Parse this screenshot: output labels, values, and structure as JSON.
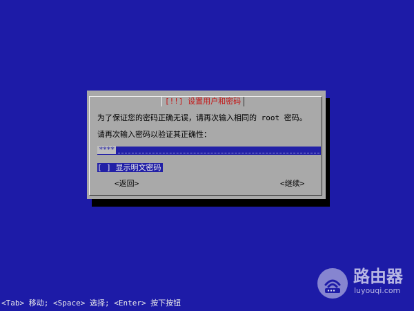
{
  "dialog": {
    "title": "[!!] 设置用户和密码",
    "instruction": "为了保证您的密码正确无误，请再次输入相同的 root 密码。",
    "prompt": "请再次输入密码以验证其正确性：",
    "password_mask": "****",
    "show_password_checkbox": "[ ]",
    "show_password_label": "显示明文密码",
    "back_button": "<返回>",
    "continue_button": "<继续>"
  },
  "footer": {
    "help": "<Tab> 移动; <Space> 选择; <Enter> 按下按钮"
  },
  "watermark": {
    "name": "路由器",
    "url": "luyouqi.com"
  },
  "colors": {
    "background": "#1d1ba7",
    "dialog": "#a9a9a9",
    "title": "#c51414",
    "selection": "#2220a6"
  }
}
